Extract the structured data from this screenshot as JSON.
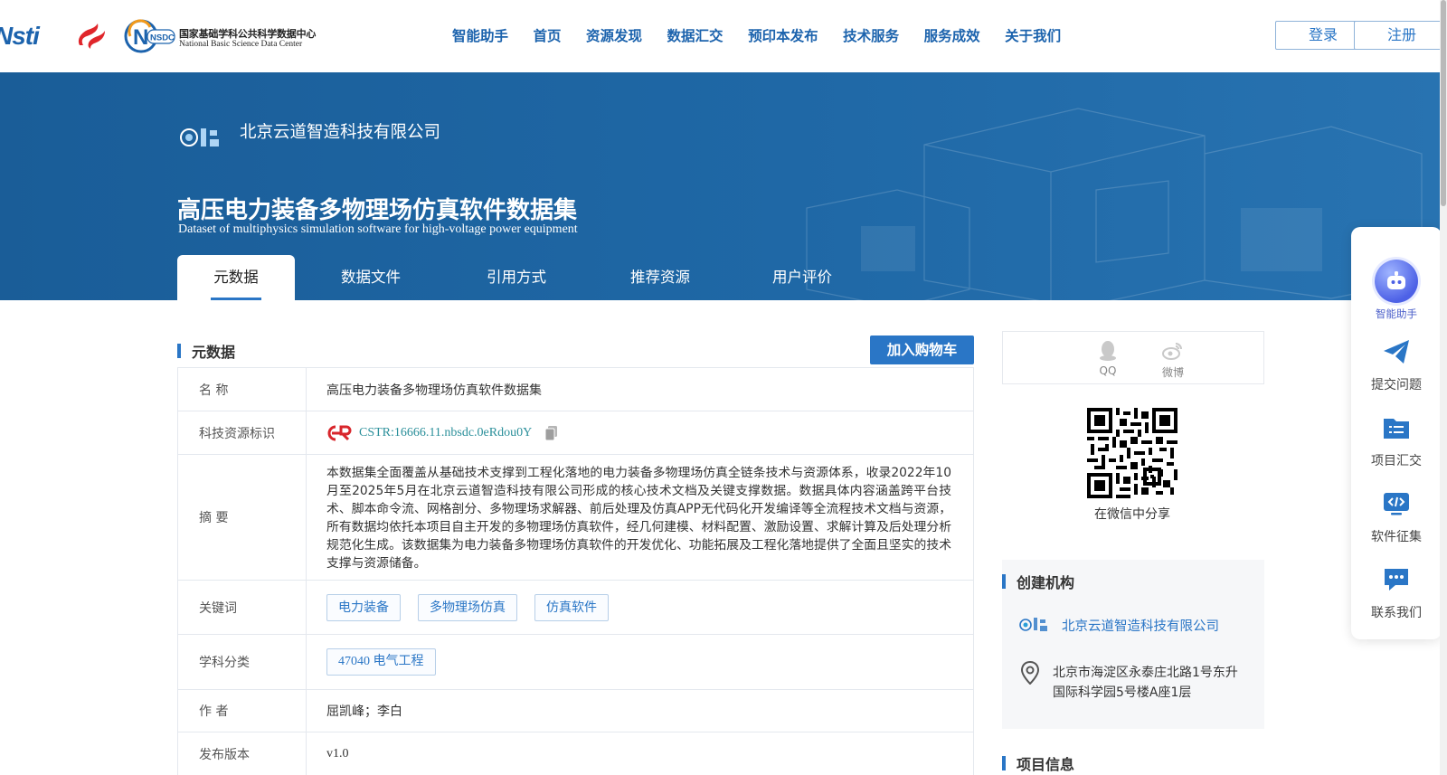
{
  "header": {
    "logo_nsti": "Nsti",
    "logo_nsdc_cn": "国家基础学科公共科学数据中心",
    "logo_nsdc_en": "National Basic Science Data Center",
    "logo_nsdc_badge": "NSDC",
    "nav": [
      "智能助手",
      "首页",
      "资源发现",
      "数据汇交",
      "预印本发布",
      "技术服务",
      "服务成效",
      "关于我们"
    ],
    "login": "登录",
    "register": "注册"
  },
  "banner": {
    "org_name": "北京云道智造科技有限公司",
    "title_cn": "高压电力装备多物理场仿真软件数据集",
    "title_en": "Dataset of multiphysics simulation software for high-voltage power equipment",
    "tabs": [
      "元数据",
      "数据文件",
      "引用方式",
      "推荐资源",
      "用户评价"
    ],
    "active_tab": 0
  },
  "metadata": {
    "section_title": "元数据",
    "add_to_cart": "加入购物车",
    "rows": {
      "name_label": "名 称",
      "name_value": "高压电力装备多物理场仿真软件数据集",
      "id_label": "科技资源标识",
      "cstr_value": "CSTR:16666.11.nbsdc.0eRdou0Y",
      "abstract_label": "摘 要",
      "abstract_value": "本数据集全面覆盖从基础技术支撑到工程化落地的电力装备多物理场仿真全链条技术与资源体系，收录2022年10月至2025年5月在北京云道智造科技有限公司形成的核心技术文档及关键支撑数据。数据具体内容涵盖跨平台技术、脚本命令流、网格剖分、多物理场求解器、前后处理及仿真APP无代码化开发编译等全流程技术文档与资源，所有数据均依托本项目自主开发的多物理场仿真软件，经几何建模、材料配置、激励设置、求解计算及后处理分析规范化生成。该数据集为电力装备多物理场仿真软件的开发优化、功能拓展及工程化落地提供了全面且坚实的技术支撑与资源储备。",
      "keywords_label": "关键词",
      "keywords": [
        "电力装备",
        "多物理场仿真",
        "仿真软件"
      ],
      "subject_label": "学科分类",
      "subject_value": "47040 电气工程",
      "author_label": "作 者",
      "author_value": "屈凯峰；李白",
      "version_label": "发布版本",
      "version_value": "v1.0"
    }
  },
  "share": {
    "qq": "QQ",
    "weibo": "微博",
    "qr_caption": "在微信中分享"
  },
  "creator": {
    "title": "创建机构",
    "org_name": "北京云道智造科技有限公司",
    "address": "北京市海淀区永泰庄北路1号东升国际科学园5号楼A座1层"
  },
  "project": {
    "title": "项目信息"
  },
  "float_bar": {
    "items": [
      "智能助手",
      "提交问题",
      "项目汇交",
      "软件征集",
      "联系我们"
    ]
  },
  "colors": {
    "primary": "#2a76c6",
    "banner": "#1f68a6",
    "ai_accent": "#4d61e6"
  }
}
